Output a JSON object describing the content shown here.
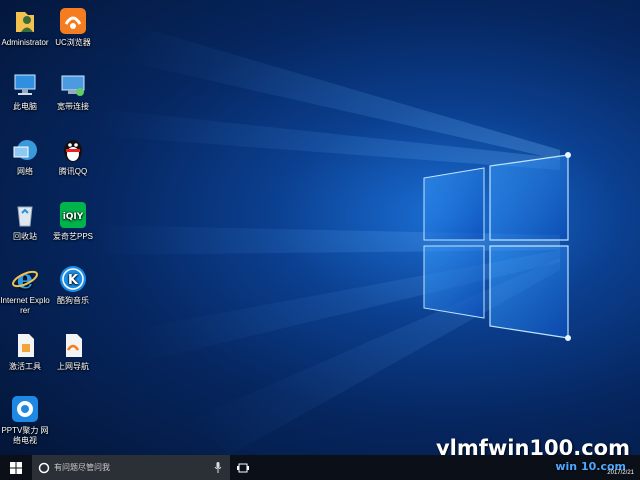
{
  "desktop": {
    "icons": [
      {
        "label": "Administrator",
        "icon": "user-folder-icon"
      },
      {
        "label": "UC浏览器",
        "icon": "uc-browser-icon"
      },
      {
        "label": "此电脑",
        "icon": "computer-icon"
      },
      {
        "label": "宽带连接",
        "icon": "broadband-connection-icon"
      },
      {
        "label": "网络",
        "icon": "network-icon"
      },
      {
        "label": "腾讯QQ",
        "icon": "qq-penguin-icon"
      },
      {
        "label": "回收站",
        "icon": "recycle-bin-icon"
      },
      {
        "label": "爱奇艺PPS",
        "icon": "iqiyi-icon"
      },
      {
        "label": "Internet Explorer",
        "icon": "internet-explorer-icon"
      },
      {
        "label": "酷狗音乐",
        "icon": "kugou-music-icon"
      },
      {
        "label": "激活工具",
        "icon": "activation-tool-icon"
      },
      {
        "label": "上网导航",
        "icon": "web-navigation-icon"
      },
      {
        "label": "PPTV聚力 网络电视",
        "icon": "pptv-icon"
      }
    ]
  },
  "taskbar": {
    "search_placeholder": "有问题尽管问我",
    "watermark": "ylmfwin100.com",
    "watermark_small": "win 10.com",
    "date": "2017/2/21"
  },
  "colors": {
    "taskbar": "#0b0f17",
    "search": "#2b2f36",
    "accent": "#1a6fd6"
  }
}
